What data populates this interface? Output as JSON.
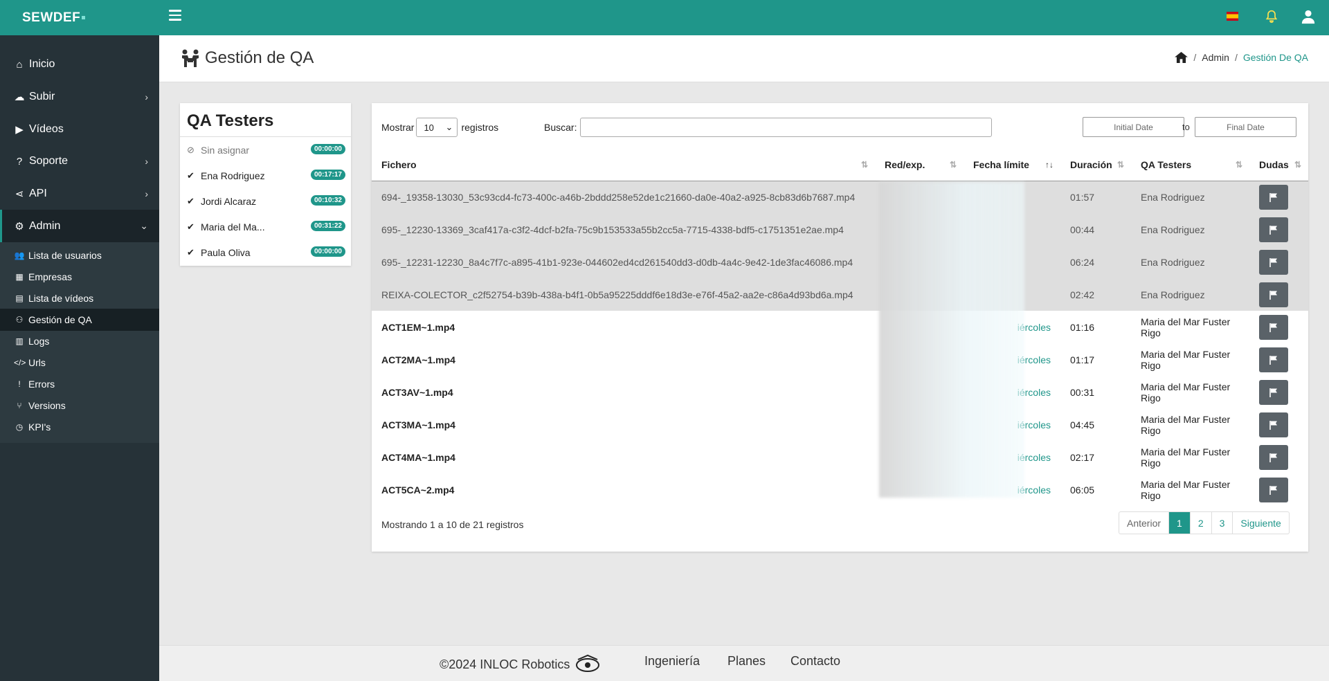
{
  "brand": {
    "name": "SEWDEF"
  },
  "sidebar": {
    "items": [
      {
        "label": "Inicio",
        "icon": "home-icon"
      },
      {
        "label": "Subir",
        "icon": "cloud-upload-icon"
      },
      {
        "label": "Vídeos",
        "icon": "video-icon"
      },
      {
        "label": "Soporte",
        "icon": "question-icon"
      },
      {
        "label": "API",
        "icon": "share-icon"
      },
      {
        "label": "Admin",
        "icon": "users-cog-icon"
      }
    ],
    "admin_sub": [
      {
        "label": "Lista de usuarios",
        "icon": "users-icon"
      },
      {
        "label": "Empresas",
        "icon": "building-icon"
      },
      {
        "label": "Lista de vídeos",
        "icon": "file-icon"
      },
      {
        "label": "Gestión de QA",
        "icon": "people-carry-icon"
      },
      {
        "label": "Logs",
        "icon": "clipboard-icon"
      },
      {
        "label": "Urls",
        "icon": "code-icon"
      },
      {
        "label": "Errors",
        "icon": "exclamation-icon"
      },
      {
        "label": "Versions",
        "icon": "branch-icon"
      },
      {
        "label": "KPI's",
        "icon": "clock-icon"
      }
    ]
  },
  "header": {
    "title": "Gestión de QA",
    "breadcrumb": {
      "admin": "Admin",
      "current": "Gestión De QA",
      "sep": "/"
    }
  },
  "qa_panel": {
    "title": "QA Testers",
    "items": [
      {
        "name": "Sin asignar",
        "time": "00:00:00",
        "icon": "user-slash-icon"
      },
      {
        "name": "Ena Rodriguez",
        "time": "00:17:17",
        "icon": "user-check-icon"
      },
      {
        "name": "Jordi Alcaraz",
        "time": "00:10:32",
        "icon": "user-check-icon"
      },
      {
        "name": "Maria del Ma...",
        "time": "00:31:22",
        "icon": "user-check-icon"
      },
      {
        "name": "Paula Oliva",
        "time": "00:00:00",
        "icon": "user-check-icon"
      }
    ]
  },
  "table_controls": {
    "show_label": "Mostrar",
    "page_size": "10",
    "records_label": "registros",
    "search_label": "Buscar:",
    "initial_date_placeholder": "Initial Date",
    "to_label": "to",
    "final_date_placeholder": "Final Date"
  },
  "table": {
    "headers": [
      "Fichero",
      "Red/exp.",
      "Fecha límite",
      "Duración",
      "QA Testers",
      "Dudas"
    ],
    "rows": [
      {
        "file": "694-_19358-13030_53c93cd4-fc73-400c-a46b-2bddd258e52de1c21660-da0e-40a2-a925-8cb83d6b7687.mp4",
        "deadline": "",
        "duration": "01:57",
        "tester": "Ena Rodriguez",
        "grey": true
      },
      {
        "file": "695-_12230-13369_3caf417a-c3f2-4dcf-b2fa-75c9b153533a55b2cc5a-7715-4338-bdf5-c1751351e2ae.mp4",
        "deadline": "",
        "duration": "00:44",
        "tester": "Ena Rodriguez",
        "grey": true
      },
      {
        "file": "695-_12231-12230_8a4c7f7c-a895-41b1-923e-044602ed4cd261540dd3-d0db-4a4c-9e42-1de3fac46086.mp4",
        "deadline": "",
        "duration": "06:24",
        "tester": "Ena Rodriguez",
        "grey": true
      },
      {
        "file": "REIXA-COLECTOR_c2f52754-b39b-438a-b4f1-0b5a95225dddf6e18d3e-e76f-45a2-aa2e-c86a4d93bd6a.mp4",
        "deadline": "",
        "duration": "02:42",
        "tester": "Ena Rodriguez",
        "grey": true
      },
      {
        "file": "ACT1EM~1.mp4",
        "deadline": "iércoles",
        "duration": "01:16",
        "tester": "Maria del Mar Fuster Rigo",
        "grey": false
      },
      {
        "file": "ACT2MA~1.mp4",
        "deadline": "iércoles",
        "duration": "01:17",
        "tester": "Maria del Mar Fuster Rigo",
        "grey": false
      },
      {
        "file": "ACT3AV~1.mp4",
        "deadline": "iércoles",
        "duration": "00:31",
        "tester": "Maria del Mar Fuster Rigo",
        "grey": false
      },
      {
        "file": "ACT3MA~1.mp4",
        "deadline": "iércoles",
        "duration": "04:45",
        "tester": "Maria del Mar Fuster Rigo",
        "grey": false
      },
      {
        "file": "ACT4MA~1.mp4",
        "deadline": "iércoles",
        "duration": "02:17",
        "tester": "Maria del Mar Fuster Rigo",
        "grey": false
      },
      {
        "file": "ACT5CA~2.mp4",
        "deadline": "iércoles",
        "duration": "06:05",
        "tester": "Maria del Mar Fuster Rigo",
        "grey": false
      }
    ]
  },
  "table_info": "Mostrando 1 a 10 de 21 registros",
  "pagination": {
    "prev": "Anterior",
    "pages": [
      "1",
      "2",
      "3"
    ],
    "next": "Siguiente",
    "current": "1"
  },
  "footer": {
    "copyright": "©2024 INLOC Robotics",
    "links": [
      "Ingeniería",
      "Planes",
      "Contacto"
    ]
  },
  "colors": {
    "accent": "#1f968a",
    "sidebar": "#263238",
    "button": "#5a6268"
  }
}
